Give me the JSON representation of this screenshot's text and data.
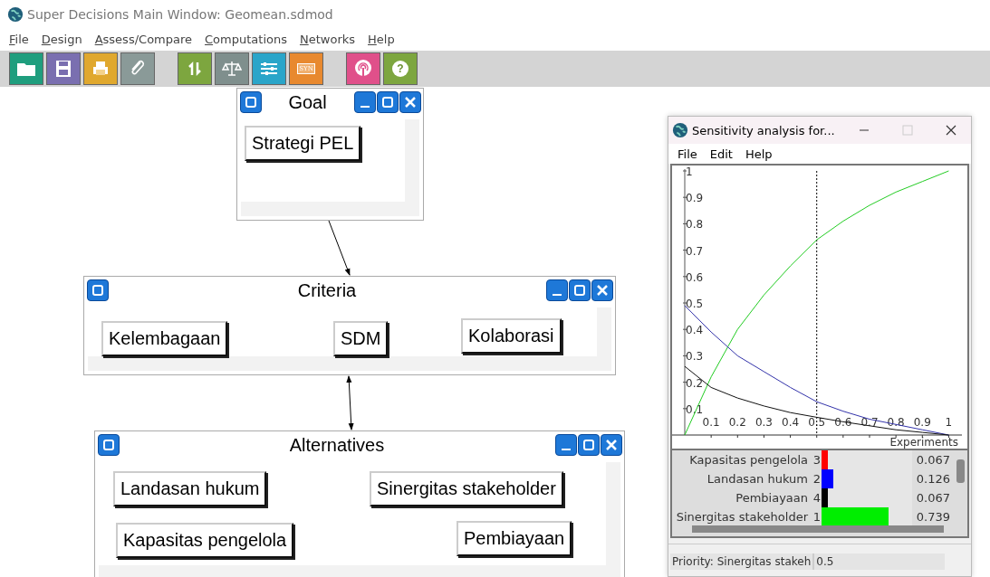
{
  "window": {
    "title": "Super Decisions Main Window: Geomean.sdmod"
  },
  "menu": [
    "File",
    "Design",
    "Assess/Compare",
    "Computations",
    "Networks",
    "Help"
  ],
  "toolbar": [
    {
      "color": "#1f9e7e"
    },
    {
      "color": "#7a6fb0"
    },
    {
      "color": "#e0a82e"
    },
    {
      "color": "#8a9a98"
    },
    {
      "color": "#7da63f"
    },
    {
      "color": "#7f8f8d"
    },
    {
      "color": "#2aa5c9"
    },
    {
      "color": "#e8892f",
      "label": "SYN"
    },
    {
      "color": "#e0508a"
    },
    {
      "color": "#7da63f",
      "label": "?"
    }
  ],
  "clusters": [
    {
      "title": "Goal",
      "nodes": [
        "Strategi PEL"
      ]
    },
    {
      "title": "Criteria",
      "nodes": [
        "Kelembagaan",
        "SDM",
        "Kolaborasi"
      ]
    },
    {
      "title": "Alternatives",
      "nodes": [
        "Landasan hukum",
        "Sinergitas stakeholder",
        "Kapasitas pengelola",
        "Pembiayaan"
      ]
    }
  ],
  "links": [
    {
      "kind": "one-way"
    },
    {
      "kind": "two-way"
    }
  ],
  "sensitivity": {
    "title": "Sensitivity analysis for...",
    "menu": [
      "File",
      "Edit",
      "Help"
    ],
    "chart_data": {
      "type": "line",
      "xlabel": "Experiments",
      "xlim": [
        0,
        1.05
      ],
      "ylim": [
        0,
        1
      ],
      "x": [
        0,
        0.1,
        0.2,
        0.3,
        0.4,
        0.5,
        0.6,
        0.7,
        0.8,
        0.9,
        1
      ],
      "xticks": [
        0.1,
        0.2,
        0.3,
        0.4,
        0.5,
        0.6,
        0.7,
        0.8,
        0.9,
        1
      ],
      "yticks": [
        0.1,
        0.2,
        0.3,
        0.4,
        0.5,
        0.6,
        0.7,
        0.8,
        0.9,
        1
      ],
      "series": [
        {
          "color": "#22cc22",
          "values": [
            0,
            0.22,
            0.4,
            0.53,
            0.64,
            0.739,
            0.81,
            0.87,
            0.92,
            0.96,
            1
          ]
        },
        {
          "color": "#3333aa",
          "values": [
            0.49,
            0.39,
            0.3,
            0.24,
            0.18,
            0.126,
            0.09,
            0.06,
            0.04,
            0.02,
            0
          ]
        },
        {
          "color": "#111111",
          "values": [
            0.26,
            0.18,
            0.14,
            0.11,
            0.085,
            0.067,
            0.05,
            0.035,
            0.02,
            0.01,
            0
          ]
        }
      ]
    },
    "results": [
      {
        "name": "Kapasitas pengelola",
        "rank": "3",
        "color": "#ff0000",
        "level": 0.067,
        "value": "0.067"
      },
      {
        "name": "Landasan hukum",
        "rank": "2",
        "color": "#0000ff",
        "level": 0.126,
        "value": "0.126"
      },
      {
        "name": "Pembiayaan",
        "rank": "4",
        "color": "#000000",
        "level": 0.067,
        "value": "0.067"
      },
      {
        "name": "Sinergitas stakeholder",
        "rank": "1",
        "color": "#00ee00",
        "level": 0.739,
        "value": "0.739"
      }
    ],
    "priority": {
      "label": "Priority: Sinergitas stakeh",
      "value": "0.5"
    }
  }
}
